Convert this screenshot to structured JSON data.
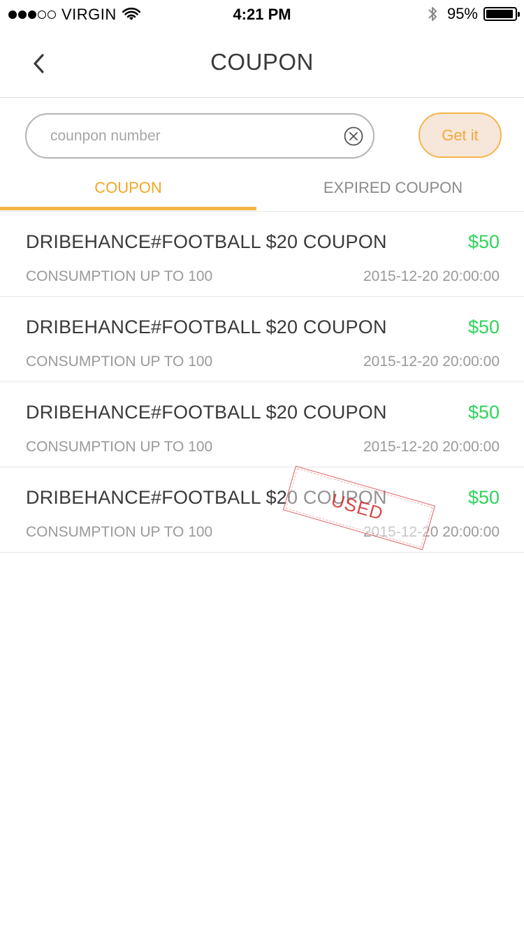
{
  "status_bar": {
    "carrier": "VIRGIN",
    "time": "4:21 PM",
    "battery": "95%",
    "battery_level": 0.95,
    "signal_filled": 3,
    "signal_total": 5
  },
  "nav": {
    "title": "COUPON",
    "back_icon": "chevron-left-icon"
  },
  "search": {
    "placeholder": "counpon number",
    "value": "",
    "clear_icon": "clear-circle-icon",
    "button_label": "Get it"
  },
  "tabs": [
    {
      "label": "COUPON",
      "active": true
    },
    {
      "label": "EXPIRED COUPON",
      "active": false
    }
  ],
  "coupons": [
    {
      "title": "DRIBEHANCE#FOOTBALL $20 COUPON",
      "amount": "$50",
      "condition": "CONSUMPTION UP TO 100",
      "date": "2015-12-20 20:00:00",
      "used": false
    },
    {
      "title": "DRIBEHANCE#FOOTBALL $20 COUPON",
      "amount": "$50",
      "condition": "CONSUMPTION UP TO 100",
      "date": "2015-12-20 20:00:00",
      "used": false
    },
    {
      "title": "DRIBEHANCE#FOOTBALL $20 COUPON",
      "amount": "$50",
      "condition": "CONSUMPTION UP TO 100",
      "date": "2015-12-20 20:00:00",
      "used": false
    },
    {
      "title": "DRIBEHANCE#FOOTBALL $20 COUPON",
      "amount": "$50",
      "condition": "CONSUMPTION UP TO 100",
      "date": "2015-12-20 20:00:00",
      "used": true,
      "stamp": "USED"
    }
  ],
  "colors": {
    "accent": "#f5a623",
    "amount": "#2fd45a",
    "stamp": "#d22828"
  }
}
